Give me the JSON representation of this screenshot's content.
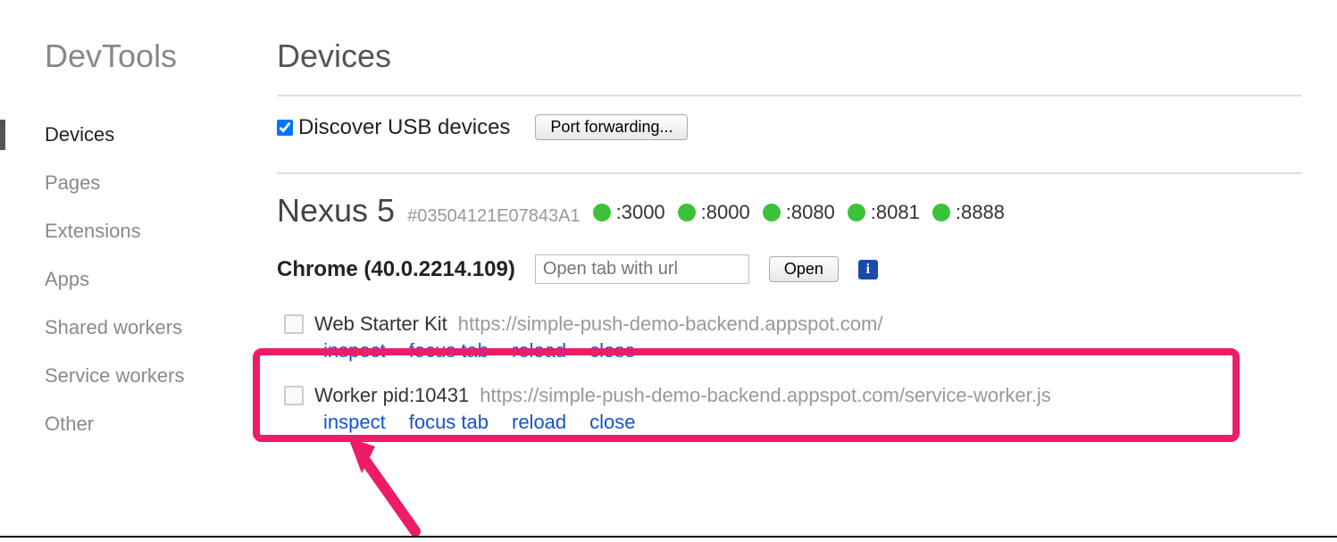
{
  "sidebar": {
    "logo": "DevTools",
    "items": [
      {
        "label": "Devices",
        "active": true
      },
      {
        "label": "Pages"
      },
      {
        "label": "Extensions"
      },
      {
        "label": "Apps"
      },
      {
        "label": "Shared workers"
      },
      {
        "label": "Service workers"
      },
      {
        "label": "Other"
      }
    ]
  },
  "main": {
    "title": "Devices",
    "discover_label": "Discover USB devices",
    "discover_checked": true,
    "port_forwarding_btn": "Port forwarding...",
    "device": {
      "name": "Nexus 5",
      "id": "#03504121E07843A1",
      "ports": [
        ":3000",
        ":8000",
        ":8080",
        ":8081",
        ":8888"
      ]
    },
    "browser": {
      "label": "Chrome (40.0.2214.109)",
      "url_placeholder": "Open tab with url",
      "open_btn": "Open"
    },
    "targets": [
      {
        "title": "Web Starter Kit",
        "url": "https://simple-push-demo-backend.appspot.com/",
        "actions": [
          "inspect",
          "focus tab",
          "reload",
          "close"
        ]
      },
      {
        "title": "Worker pid:10431",
        "url": "https://simple-push-demo-backend.appspot.com/service-worker.js",
        "actions": [
          "inspect",
          "focus tab",
          "reload",
          "close"
        ]
      }
    ]
  },
  "colors": {
    "green": "#3bc23b",
    "link": "#1155cc",
    "highlight": "#ec1c68"
  }
}
